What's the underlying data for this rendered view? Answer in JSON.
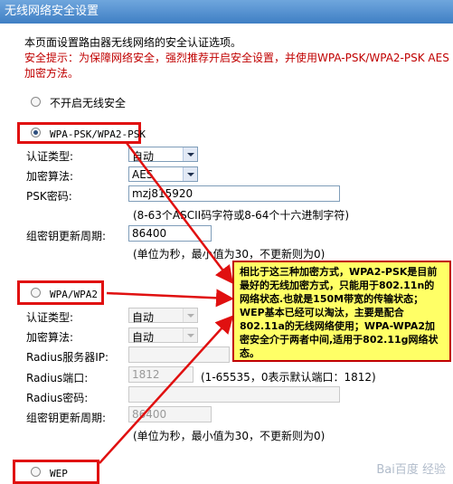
{
  "window": {
    "title": "无线网络安全设置"
  },
  "intro": "本页面设置路由器无线网络的安全认证选项。",
  "note_line1": "安全提示：为保障网络安全，强烈推荐开启安全设置，并使用WPA-PSK/WPA2-PSK AES",
  "note_line2": "加密方法。",
  "options": {
    "none": "不开启无线安全",
    "wpa_psk": "WPA-PSK/WPA2-PSK",
    "wpa": "WPA/WPA2",
    "wep": "WEP"
  },
  "psk": {
    "auth_label": "认证类型:",
    "auth_value": "自动",
    "enc_label": "加密算法:",
    "enc_value": "AES",
    "key_label": "PSK密码:",
    "key_value": "mzj815920",
    "key_hint": "(8-63个ASCII码字符或8-64个十六进制字符)",
    "renew_label": "组密钥更新周期:",
    "renew_value": "86400",
    "renew_hint": "(单位为秒，最小值为30，不更新则为0)"
  },
  "wpa": {
    "auth_label": "认证类型:",
    "auth_value": "自动",
    "enc_label": "加密算法:",
    "enc_value": "自动",
    "server_ip_label": "Radius服务器IP:",
    "port_label": "Radius端口:",
    "port_value": "1812",
    "port_hint": "(1-65535，0表示默认端口：1812)",
    "pwd_label": "Radius密码:",
    "renew_label": "组密钥更新周期:",
    "renew_value": "86400",
    "renew_hint": "(单位为秒，最小值为30，不更新则为0)"
  },
  "callout": "相比于这三种加密方式，WPA2-PSK是目前最好的无线加密方式，只能用于802.11n的网络状态.也就是150M带宽的传输状态；WEP基本已经可以淘汰，主要是配合802.11a的无线网络使用；WPA-WPA2加密安全介于两者中间,适用于802.11g网络状态。",
  "watermark": "Bai百度 经验",
  "selected_option": "wpa_psk"
}
